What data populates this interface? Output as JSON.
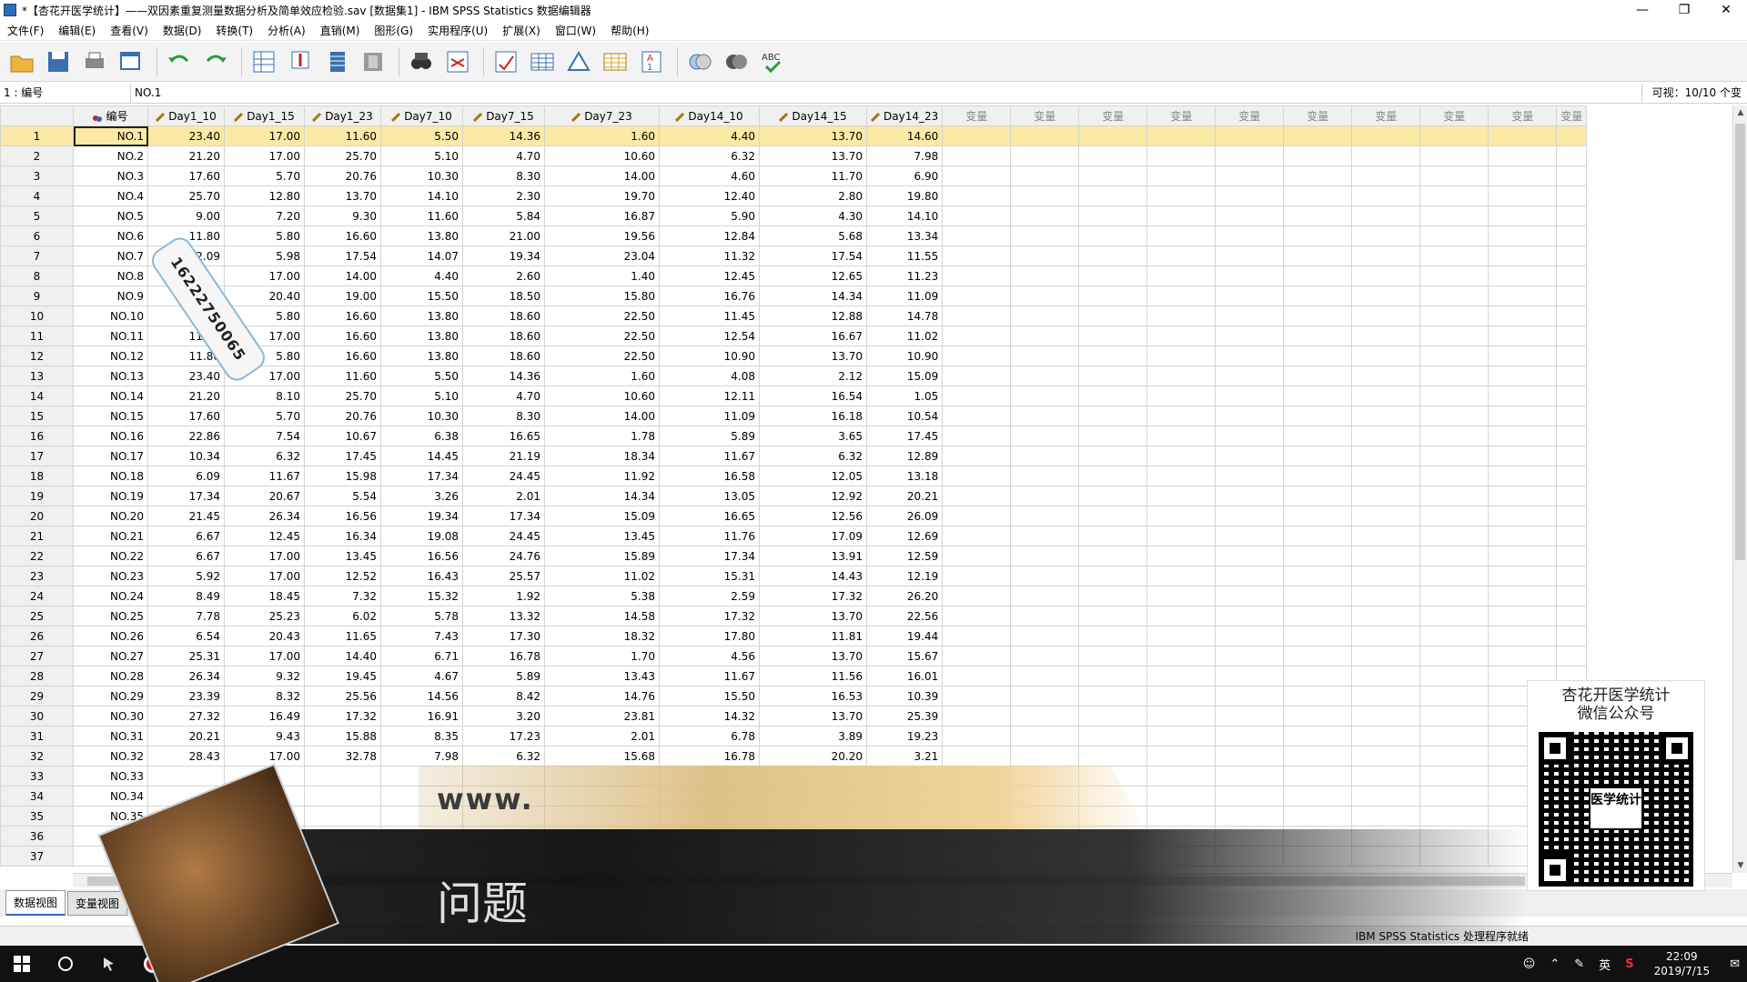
{
  "window": {
    "title": "*【杏花开医学统计】——双因素重复测量数据分析及简单效应检验.sav [数据集1] - IBM SPSS Statistics 数据编辑器"
  },
  "menu": [
    "文件(F)",
    "编辑(E)",
    "查看(V)",
    "数据(D)",
    "转换(T)",
    "分析(A)",
    "直销(M)",
    "图形(G)",
    "实用程序(U)",
    "扩展(X)",
    "窗口(W)",
    "帮助(H)"
  ],
  "toolbar": [
    {
      "icon": "open-folder-icon"
    },
    {
      "icon": "save-icon"
    },
    {
      "icon": "print-icon"
    },
    {
      "icon": "recall-dialog-icon"
    },
    {
      "icon": "undo-icon"
    },
    {
      "icon": "redo-icon"
    },
    {
      "icon": "goto-case-icon"
    },
    {
      "icon": "goto-variable-icon"
    },
    {
      "icon": "variables-icon"
    },
    {
      "icon": "run-descriptives-icon"
    },
    {
      "icon": "find-icon"
    },
    {
      "icon": "insert-cases-icon"
    },
    {
      "icon": "insert-variable-icon"
    },
    {
      "icon": "split-file-icon"
    },
    {
      "icon": "weight-cases-icon"
    },
    {
      "icon": "select-cases-icon"
    },
    {
      "icon": "value-labels-icon"
    },
    {
      "icon": "use-sets-icon"
    },
    {
      "icon": "show-all-variables-icon"
    },
    {
      "icon": "spell-check-icon"
    }
  ],
  "cellbar": {
    "ref": "1 : 编号",
    "value": "NO.1",
    "visible": "可视：10/10 个变量"
  },
  "columns": [
    "编号",
    "Day1_10",
    "Day1_15",
    "Day1_23",
    "Day7_10",
    "Day7_15",
    "Day7_23",
    "Day14_10",
    "Day14_15",
    "Day14_23"
  ],
  "empty_columns": [
    "变量",
    "变量",
    "变量",
    "变量",
    "变量",
    "变量",
    "变量",
    "变量",
    "变量",
    "变量"
  ],
  "rows": [
    [
      "NO.1",
      "23.40",
      "17.00",
      "11.60",
      "5.50",
      "14.36",
      "1.60",
      "4.40",
      "13.70",
      "14.60"
    ],
    [
      "NO.2",
      "21.20",
      "17.00",
      "25.70",
      "5.10",
      "4.70",
      "10.60",
      "6.32",
      "13.70",
      "7.98"
    ],
    [
      "NO.3",
      "17.60",
      "5.70",
      "20.76",
      "10.30",
      "8.30",
      "14.00",
      "4.60",
      "11.70",
      "6.90"
    ],
    [
      "NO.4",
      "25.70",
      "12.80",
      "13.70",
      "14.10",
      "2.30",
      "19.70",
      "12.40",
      "2.80",
      "19.80"
    ],
    [
      "NO.5",
      "9.00",
      "7.20",
      "9.30",
      "11.60",
      "5.84",
      "16.87",
      "5.90",
      "4.30",
      "14.10"
    ],
    [
      "NO.6",
      "11.80",
      "5.80",
      "16.60",
      "13.80",
      "21.00",
      "19.56",
      "12.84",
      "5.68",
      "13.34"
    ],
    [
      "NO.7",
      "12.09",
      "5.98",
      "17.54",
      "14.07",
      "19.34",
      "23.04",
      "11.32",
      "17.54",
      "11.55"
    ],
    [
      "NO.8",
      "",
      "17.00",
      "14.00",
      "4.40",
      "2.60",
      "1.40",
      "12.45",
      "12.65",
      "11.23"
    ],
    [
      "NO.9",
      "",
      "20.40",
      "19.00",
      "15.50",
      "18.50",
      "15.80",
      "16.76",
      "14.34",
      "11.09"
    ],
    [
      "NO.10",
      "11.80",
      "5.80",
      "16.60",
      "13.80",
      "18.60",
      "22.50",
      "11.45",
      "12.88",
      "14.78"
    ],
    [
      "NO.11",
      "11.80",
      "17.00",
      "16.60",
      "13.80",
      "18.60",
      "22.50",
      "12.54",
      "16.67",
      "11.02"
    ],
    [
      "NO.12",
      "11.80",
      "5.80",
      "16.60",
      "13.80",
      "18.60",
      "22.50",
      "10.90",
      "13.70",
      "10.90"
    ],
    [
      "NO.13",
      "23.40",
      "17.00",
      "11.60",
      "5.50",
      "14.36",
      "1.60",
      "4.08",
      "2.12",
      "15.09"
    ],
    [
      "NO.14",
      "21.20",
      "8.10",
      "25.70",
      "5.10",
      "4.70",
      "10.60",
      "12.11",
      "16.54",
      "1.05"
    ],
    [
      "NO.15",
      "17.60",
      "5.70",
      "20.76",
      "10.30",
      "8.30",
      "14.00",
      "11.09",
      "16.18",
      "10.54"
    ],
    [
      "NO.16",
      "22.86",
      "7.54",
      "10.67",
      "6.38",
      "16.65",
      "1.78",
      "5.89",
      "3.65",
      "17.45"
    ],
    [
      "NO.17",
      "10.34",
      "6.32",
      "17.45",
      "14.45",
      "21.19",
      "18.34",
      "11.67",
      "6.32",
      "12.89"
    ],
    [
      "NO.18",
      "6.09",
      "11.67",
      "15.98",
      "17.34",
      "24.45",
      "11.92",
      "16.58",
      "12.05",
      "13.18"
    ],
    [
      "NO.19",
      "17.34",
      "20.67",
      "5.54",
      "3.26",
      "2.01",
      "14.34",
      "13.05",
      "12.92",
      "20.21"
    ],
    [
      "NO.20",
      "21.45",
      "26.34",
      "16.56",
      "19.34",
      "17.34",
      "15.09",
      "16.65",
      "12.56",
      "26.09"
    ],
    [
      "NO.21",
      "6.67",
      "12.45",
      "16.34",
      "19.08",
      "24.45",
      "13.45",
      "11.76",
      "17.09",
      "12.69"
    ],
    [
      "NO.22",
      "6.67",
      "17.00",
      "13.45",
      "16.56",
      "24.76",
      "15.89",
      "17.34",
      "13.91",
      "12.59"
    ],
    [
      "NO.23",
      "5.92",
      "17.00",
      "12.52",
      "16.43",
      "25.57",
      "11.02",
      "15.31",
      "14.43",
      "12.19"
    ],
    [
      "NO.24",
      "8.49",
      "18.45",
      "7.32",
      "15.32",
      "1.92",
      "5.38",
      "2.59",
      "17.32",
      "26.20"
    ],
    [
      "NO.25",
      "7.78",
      "25.23",
      "6.02",
      "5.78",
      "13.32",
      "14.58",
      "17.32",
      "13.70",
      "22.56"
    ],
    [
      "NO.26",
      "6.54",
      "20.43",
      "11.65",
      "7.43",
      "17.30",
      "18.32",
      "17.80",
      "11.81",
      "19.44"
    ],
    [
      "NO.27",
      "25.31",
      "17.00",
      "14.40",
      "6.71",
      "16.78",
      "1.70",
      "4.56",
      "13.70",
      "15.67"
    ],
    [
      "NO.28",
      "26.34",
      "9.32",
      "19.45",
      "4.67",
      "5.89",
      "13.43",
      "11.67",
      "11.56",
      "16.01"
    ],
    [
      "NO.29",
      "23.39",
      "8.32",
      "25.56",
      "14.56",
      "8.42",
      "14.76",
      "15.50",
      "16.53",
      "10.39"
    ],
    [
      "NO.30",
      "27.32",
      "16.49",
      "17.32",
      "16.91",
      "3.20",
      "23.81",
      "14.32",
      "13.70",
      "25.39"
    ],
    [
      "NO.31",
      "20.21",
      "9.43",
      "15.88",
      "8.35",
      "17.23",
      "2.01",
      "6.78",
      "3.89",
      "19.23"
    ],
    [
      "NO.32",
      "28.43",
      "17.00",
      "32.78",
      "7.98",
      "6.32",
      "15.68",
      "16.78",
      "20.20",
      "3.21"
    ],
    [
      "NO.33",
      "",
      "",
      "",
      "",
      "",
      "",
      "",
      "",
      ""
    ],
    [
      "NO.34",
      "",
      "",
      "",
      "",
      "",
      "",
      "",
      "",
      ""
    ],
    [
      "NO.35",
      "",
      "",
      "",
      "",
      "",
      "",
      "",
      "",
      ""
    ],
    [
      "",
      "",
      "",
      "",
      "",
      "",
      "",
      "",
      "",
      ""
    ],
    [
      "",
      "",
      "",
      "",
      "",
      "",
      "",
      "",
      "",
      ""
    ]
  ],
  "tabs": [
    "数据视图",
    "变量视图"
  ],
  "status": "IBM SPSS Statistics 处理程序就绪",
  "overlay": {
    "www": "www.",
    "question": "问题",
    "watermark": "16222750065",
    "qr_line1": "杏花开医学统计",
    "qr_line2": "微信公众号",
    "qr_mid": "医学统计"
  },
  "taskbar": {
    "ime": "英",
    "time": "22:09",
    "date": "2019/7/15"
  },
  "colors": {
    "selected_row": "#fbe9a5",
    "grid_border": "#d5d5d5",
    "header_bg": "#f0f0f0"
  }
}
